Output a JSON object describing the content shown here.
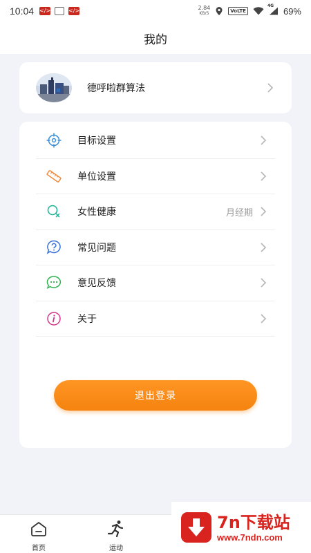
{
  "status_bar": {
    "time": "10:04",
    "net_speed_value": "2.84",
    "net_speed_unit": "KB/S",
    "volte": "VoLTE",
    "signal": "4G",
    "battery": "69%"
  },
  "header": {
    "title": "我的"
  },
  "profile": {
    "name": "德呼啦群算法"
  },
  "menu": {
    "items": [
      {
        "label": "目标设置",
        "value": "",
        "icon": "target-icon"
      },
      {
        "label": "单位设置",
        "value": "",
        "icon": "ruler-icon"
      },
      {
        "label": "女性健康",
        "value": "月经期",
        "icon": "female-health-icon"
      },
      {
        "label": "常见问题",
        "value": "",
        "icon": "question-icon"
      },
      {
        "label": "意见反馈",
        "value": "",
        "icon": "feedback-icon"
      },
      {
        "label": "关于",
        "value": "",
        "icon": "info-icon"
      }
    ]
  },
  "logout": {
    "label": "退出登录"
  },
  "tabbar": {
    "tabs": [
      {
        "label": "首页",
        "icon": "home-icon"
      },
      {
        "label": "运动",
        "icon": "running-icon"
      }
    ]
  },
  "watermark": {
    "title": "7n下载站",
    "url": "www.7ndn.com"
  },
  "colors": {
    "accent": "#f5830f",
    "background": "#f1f3f9",
    "watermark": "#d8231e"
  }
}
